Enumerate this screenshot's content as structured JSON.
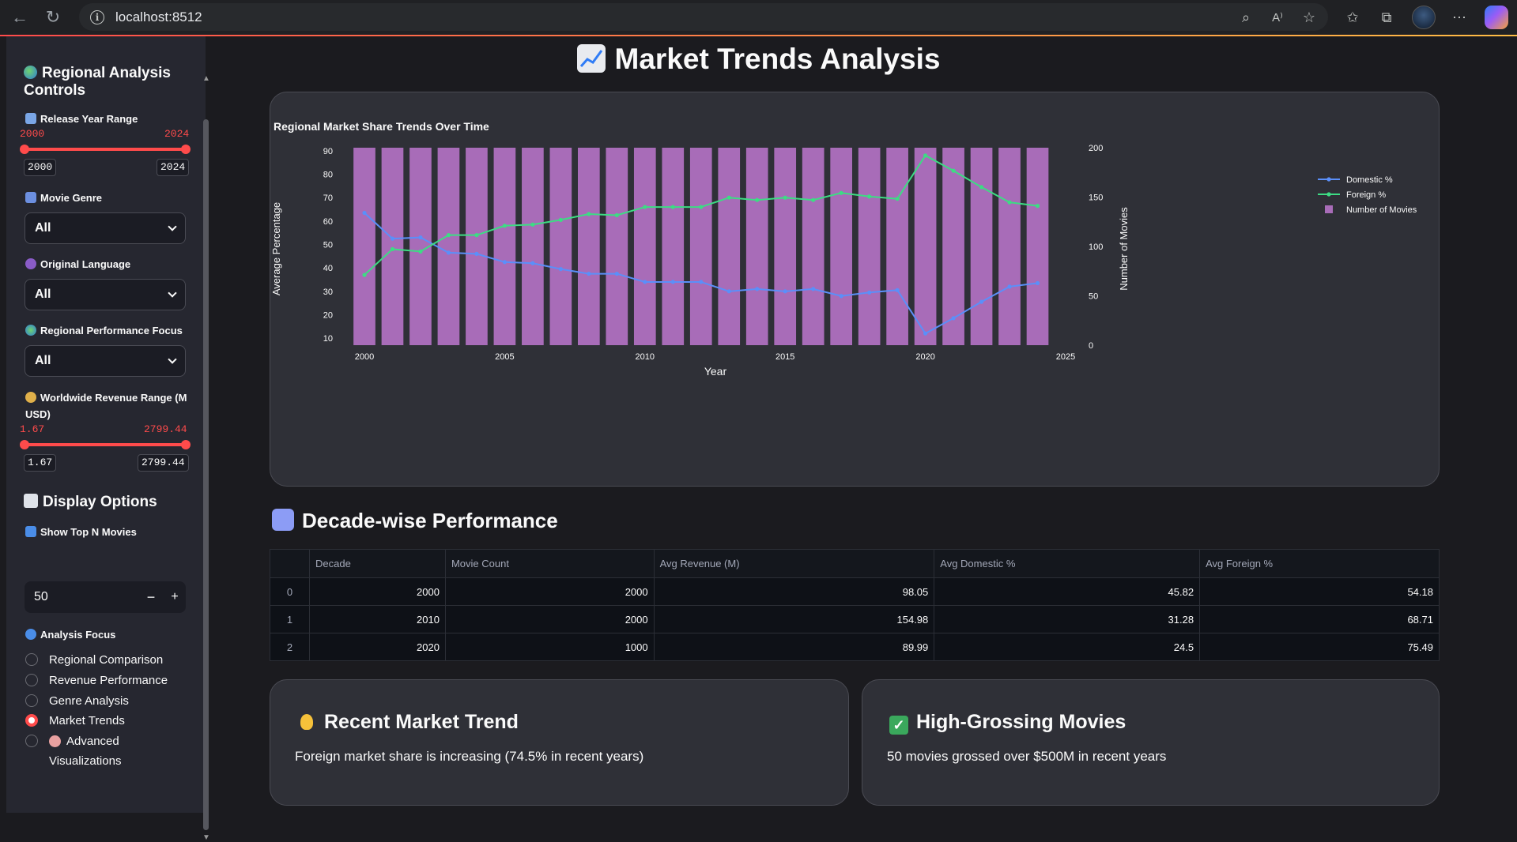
{
  "browser": {
    "url": "localhost:8512"
  },
  "sidebar": {
    "heading": "Regional Analysis Controls",
    "year_range": {
      "label": "Release Year Range",
      "min": "2000",
      "max": "2024",
      "min_box": "2000",
      "max_box": "2024"
    },
    "genre": {
      "label": "Movie Genre",
      "value": "All"
    },
    "language": {
      "label": "Original Language",
      "value": "All"
    },
    "region_focus": {
      "label": "Regional Performance Focus",
      "value": "All"
    },
    "revenue_range": {
      "label_line1": "Worldwide Revenue Range (M",
      "label_line2": "USD)",
      "min": "1.67",
      "max": "2799.44",
      "min_box": "1.67",
      "max_box": "2799.44"
    },
    "display_heading": "Display Options",
    "top_n": {
      "label": "Show Top N Movies",
      "value": "50",
      "minus": "−",
      "plus": "+"
    },
    "analysis_focus": {
      "label": "Analysis Focus",
      "options": [
        "Regional Comparison",
        "Revenue Performance",
        "Genre Analysis",
        "Market Trends",
        "Advanced",
        "Visualizations"
      ],
      "selected": "Market Trends"
    }
  },
  "main": {
    "title": "Market Trends Analysis",
    "decade_heading": "Decade-wise Performance",
    "table": {
      "columns": [
        "",
        "Decade",
        "Movie Count",
        "Avg Revenue (M)",
        "Avg Domestic %",
        "Avg Foreign %"
      ],
      "rows": [
        [
          "0",
          "2000",
          "2000",
          "98.05",
          "45.82",
          "54.18"
        ],
        [
          "1",
          "2010",
          "2000",
          "154.98",
          "31.28",
          "68.71"
        ],
        [
          "2",
          "2020",
          "1000",
          "89.99",
          "24.5",
          "75.49"
        ]
      ]
    },
    "trend_card": {
      "title": "Recent Market Trend",
      "text": "Foreign market share is increasing (74.5% in recent years)"
    },
    "gross_card": {
      "title": "High-Grossing Movies",
      "text": "50 movies grossed over $500M in recent years"
    }
  },
  "colors": {
    "domestic": "#5b8ff9",
    "foreign": "#3ddc84",
    "bars": "#a86cb8",
    "accent": "#ff4b4b"
  },
  "chart_data": {
    "type": "bar",
    "title": "Regional Market Share Trends Over Time",
    "xlabel": "Year",
    "ylabel": "Average Percentage",
    "y2label": "Number of Movies",
    "x": [
      2000,
      2001,
      2002,
      2003,
      2004,
      2005,
      2006,
      2007,
      2008,
      2009,
      2010,
      2011,
      2012,
      2013,
      2014,
      2015,
      2016,
      2017,
      2018,
      2019,
      2020,
      2021,
      2022,
      2023,
      2024
    ],
    "xlim": [
      2000,
      2025
    ],
    "xticks": [
      "2000",
      "2005",
      "2010",
      "2015",
      "2020",
      "2025"
    ],
    "ylim": [
      7,
      92
    ],
    "yticks": [
      "10",
      "20",
      "30",
      "40",
      "50",
      "60",
      "70",
      "80",
      "90"
    ],
    "y2lim": [
      0,
      200
    ],
    "y2ticks": [
      "0",
      "50",
      "100",
      "150",
      "200"
    ],
    "series": [
      {
        "name": "Domestic %",
        "type": "line",
        "axis": "y",
        "values": [
          63.5,
          52.5,
          53,
          46.5,
          46,
          42.5,
          42,
          39.5,
          37.5,
          37.5,
          34,
          34,
          34,
          30,
          31,
          30,
          31,
          28,
          29.5,
          30.5,
          12,
          18.5,
          25.5,
          32,
          33.5
        ]
      },
      {
        "name": "Foreign %",
        "type": "line",
        "axis": "y",
        "values": [
          37,
          48,
          47,
          54,
          54,
          58,
          58.5,
          60.5,
          63,
          62.5,
          66,
          66,
          66,
          70,
          69,
          70,
          69,
          72,
          70.5,
          69.5,
          88,
          81.5,
          74.5,
          68,
          66.5
        ]
      },
      {
        "name": "Number of Movies",
        "type": "bar",
        "axis": "y2",
        "values": [
          200,
          200,
          200,
          200,
          200,
          200,
          200,
          200,
          200,
          200,
          200,
          200,
          200,
          200,
          200,
          200,
          200,
          200,
          200,
          200,
          200,
          200,
          200,
          200,
          200
        ]
      }
    ],
    "legend_position": "top-right",
    "grid": false
  }
}
